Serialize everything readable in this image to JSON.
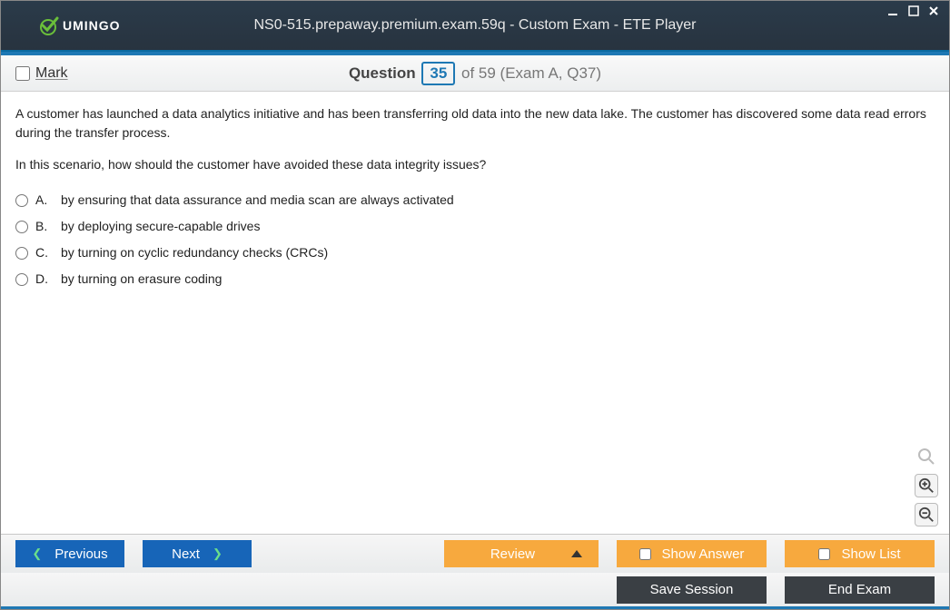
{
  "app": {
    "brand": "UMINGO",
    "title": "NS0-515.prepaway.premium.exam.59q - Custom Exam - ETE Player"
  },
  "qheader": {
    "mark_label": "Mark",
    "question_word": "Question",
    "current": "35",
    "of_text": "of 59 (Exam A, Q37)"
  },
  "question": {
    "para1": "A customer has launched a data analytics initiative and has been transferring old data into the new data lake. The customer has discovered some data read errors during the transfer process.",
    "para2": "In this scenario, how should the customer have avoided these data integrity issues?",
    "options": [
      {
        "letter": "A.",
        "text": "by ensuring that data assurance and media scan are always activated"
      },
      {
        "letter": "B.",
        "text": "by deploying secure-capable drives"
      },
      {
        "letter": "C.",
        "text": "by turning on cyclic redundancy checks (CRCs)"
      },
      {
        "letter": "D.",
        "text": "by turning on erasure coding"
      }
    ]
  },
  "buttons": {
    "previous": "Previous",
    "next": "Next",
    "review": "Review",
    "show_answer": "Show Answer",
    "show_list": "Show List",
    "save_session": "Save Session",
    "end_exam": "End Exam"
  }
}
